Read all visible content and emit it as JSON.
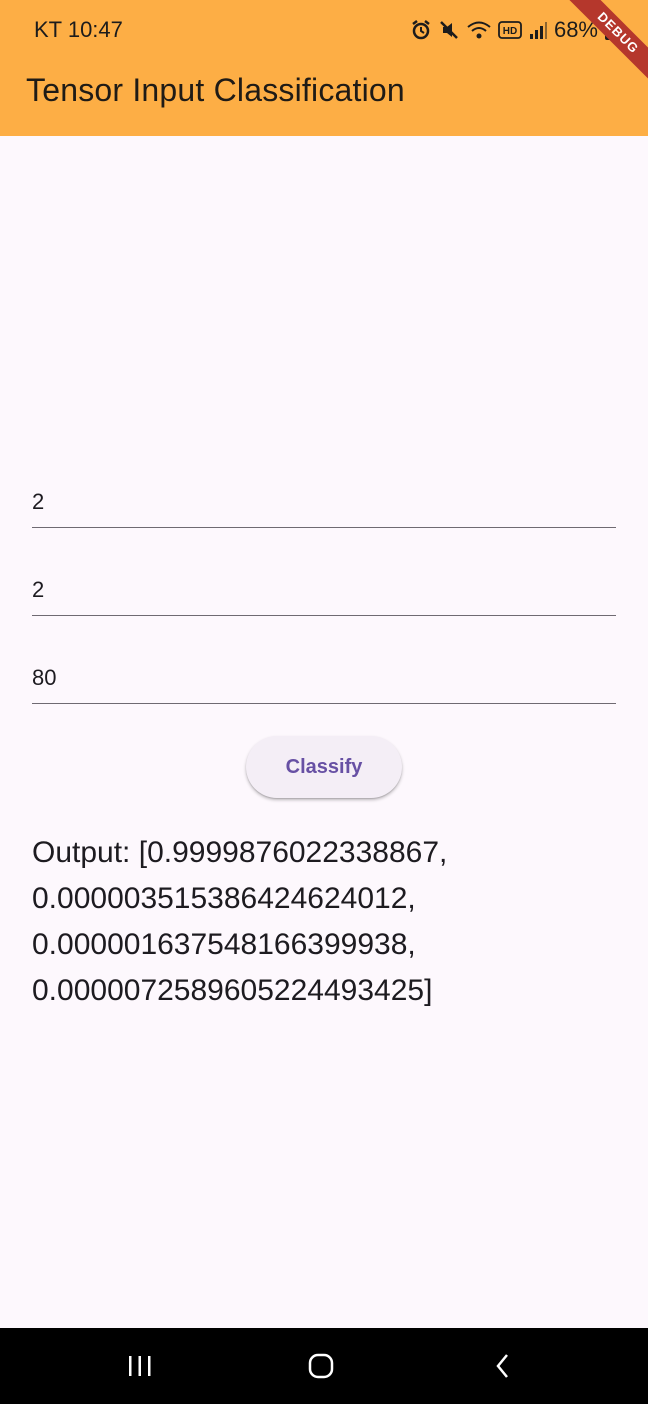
{
  "status_bar": {
    "time": "KT 10:47",
    "battery": "68%",
    "icons": [
      "alarm-icon",
      "mute-icon",
      "wifi-icon",
      "hd-icon",
      "signal-icon",
      "battery-icon"
    ]
  },
  "app_bar": {
    "title": "Tensor Input Classification",
    "color": "#fdae45"
  },
  "debug_banner": {
    "label": "DEBUG",
    "color": "#b5372c"
  },
  "form": {
    "field_1": {
      "value": "2"
    },
    "field_2": {
      "value": "2"
    },
    "field_3": {
      "value": "80"
    },
    "classify_label": "Classify"
  },
  "output": {
    "text": "Output: [0.9999876022338867, 0.0000035153864246240​12, 0.0000016375481663999​38, 0.0000072589605224493425]"
  },
  "nav_bar": {
    "icons": [
      "recents-icon",
      "home-icon",
      "back-icon"
    ]
  }
}
